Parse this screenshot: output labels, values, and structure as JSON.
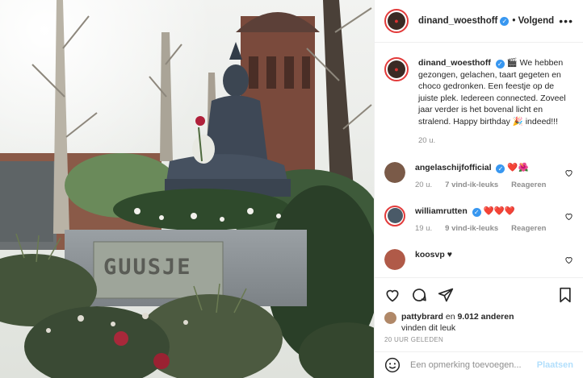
{
  "header": {
    "username": "dinand_woesthoff",
    "follow_label": "• Volgend",
    "more_icon": "more-horizontal-icon"
  },
  "post": {
    "image_text": "GUUSJE",
    "caption_user": "dinand_woesthoff",
    "caption_text": "🎬 We hebben gezongen, gelachen, taart gegeten en choco gedronken. Een feestje op de juiste plek. Iedereen connected. Zoveel jaar verder is het bovenal licht en stralend. Happy birthday 🎉 indeed!!!",
    "caption_time": "20 u."
  },
  "comments": [
    {
      "user": "angelaschijfofficial",
      "text": "❤️🌺",
      "time": "20 u.",
      "likes": "7 vind-ik-leuks",
      "reply": "Reageren",
      "avatar_color": "#7a5a48"
    },
    {
      "user": "williamrutten",
      "text": "❤️❤️❤️",
      "time": "19 u.",
      "likes": "9 vind-ik-leuks",
      "reply": "Reageren",
      "avatar_color": "#4a5a68"
    },
    {
      "user": "koosvp",
      "text": "♥",
      "time": "",
      "likes": "",
      "reply": "",
      "avatar_color": "#b05a48"
    }
  ],
  "actions": {
    "icons": [
      "heart-icon",
      "comment-icon",
      "share-icon",
      "bookmark-icon"
    ]
  },
  "likes": {
    "liker": "pattybrard",
    "and_text": "en",
    "count": "9.012 anderen",
    "suffix": "vinden dit leuk"
  },
  "time_ago": "20 UUR GELEDEN",
  "add_comment": {
    "placeholder": "Een opmerking toevoegen...",
    "post_label": "Plaatsen"
  },
  "colors": {
    "story_ring": "#e23a3a",
    "verified": "#3897f0",
    "post_disabled": "#b2dffc"
  }
}
